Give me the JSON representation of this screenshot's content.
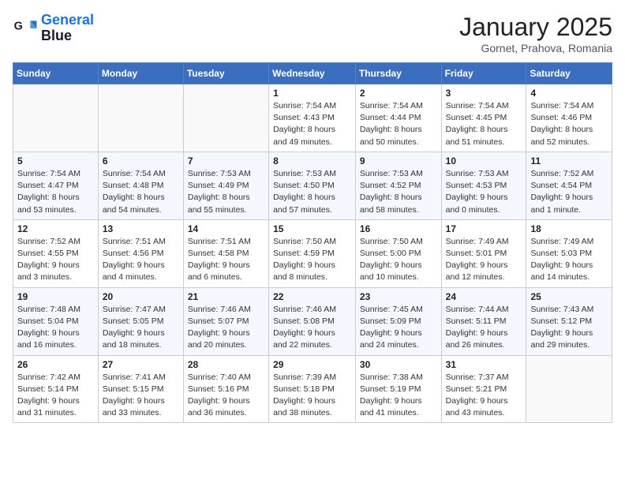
{
  "logo": {
    "line1": "General",
    "line2": "Blue"
  },
  "title": "January 2025",
  "location": "Gornet, Prahova, Romania",
  "weekdays": [
    "Sunday",
    "Monday",
    "Tuesday",
    "Wednesday",
    "Thursday",
    "Friday",
    "Saturday"
  ],
  "weeks": [
    [
      {
        "day": "",
        "info": ""
      },
      {
        "day": "",
        "info": ""
      },
      {
        "day": "",
        "info": ""
      },
      {
        "day": "1",
        "info": "Sunrise: 7:54 AM\nSunset: 4:43 PM\nDaylight: 8 hours\nand 49 minutes."
      },
      {
        "day": "2",
        "info": "Sunrise: 7:54 AM\nSunset: 4:44 PM\nDaylight: 8 hours\nand 50 minutes."
      },
      {
        "day": "3",
        "info": "Sunrise: 7:54 AM\nSunset: 4:45 PM\nDaylight: 8 hours\nand 51 minutes."
      },
      {
        "day": "4",
        "info": "Sunrise: 7:54 AM\nSunset: 4:46 PM\nDaylight: 8 hours\nand 52 minutes."
      }
    ],
    [
      {
        "day": "5",
        "info": "Sunrise: 7:54 AM\nSunset: 4:47 PM\nDaylight: 8 hours\nand 53 minutes."
      },
      {
        "day": "6",
        "info": "Sunrise: 7:54 AM\nSunset: 4:48 PM\nDaylight: 8 hours\nand 54 minutes."
      },
      {
        "day": "7",
        "info": "Sunrise: 7:53 AM\nSunset: 4:49 PM\nDaylight: 8 hours\nand 55 minutes."
      },
      {
        "day": "8",
        "info": "Sunrise: 7:53 AM\nSunset: 4:50 PM\nDaylight: 8 hours\nand 57 minutes."
      },
      {
        "day": "9",
        "info": "Sunrise: 7:53 AM\nSunset: 4:52 PM\nDaylight: 8 hours\nand 58 minutes."
      },
      {
        "day": "10",
        "info": "Sunrise: 7:53 AM\nSunset: 4:53 PM\nDaylight: 9 hours\nand 0 minutes."
      },
      {
        "day": "11",
        "info": "Sunrise: 7:52 AM\nSunset: 4:54 PM\nDaylight: 9 hours\nand 1 minute."
      }
    ],
    [
      {
        "day": "12",
        "info": "Sunrise: 7:52 AM\nSunset: 4:55 PM\nDaylight: 9 hours\nand 3 minutes."
      },
      {
        "day": "13",
        "info": "Sunrise: 7:51 AM\nSunset: 4:56 PM\nDaylight: 9 hours\nand 4 minutes."
      },
      {
        "day": "14",
        "info": "Sunrise: 7:51 AM\nSunset: 4:58 PM\nDaylight: 9 hours\nand 6 minutes."
      },
      {
        "day": "15",
        "info": "Sunrise: 7:50 AM\nSunset: 4:59 PM\nDaylight: 9 hours\nand 8 minutes."
      },
      {
        "day": "16",
        "info": "Sunrise: 7:50 AM\nSunset: 5:00 PM\nDaylight: 9 hours\nand 10 minutes."
      },
      {
        "day": "17",
        "info": "Sunrise: 7:49 AM\nSunset: 5:01 PM\nDaylight: 9 hours\nand 12 minutes."
      },
      {
        "day": "18",
        "info": "Sunrise: 7:49 AM\nSunset: 5:03 PM\nDaylight: 9 hours\nand 14 minutes."
      }
    ],
    [
      {
        "day": "19",
        "info": "Sunrise: 7:48 AM\nSunset: 5:04 PM\nDaylight: 9 hours\nand 16 minutes."
      },
      {
        "day": "20",
        "info": "Sunrise: 7:47 AM\nSunset: 5:05 PM\nDaylight: 9 hours\nand 18 minutes."
      },
      {
        "day": "21",
        "info": "Sunrise: 7:46 AM\nSunset: 5:07 PM\nDaylight: 9 hours\nand 20 minutes."
      },
      {
        "day": "22",
        "info": "Sunrise: 7:46 AM\nSunset: 5:08 PM\nDaylight: 9 hours\nand 22 minutes."
      },
      {
        "day": "23",
        "info": "Sunrise: 7:45 AM\nSunset: 5:09 PM\nDaylight: 9 hours\nand 24 minutes."
      },
      {
        "day": "24",
        "info": "Sunrise: 7:44 AM\nSunset: 5:11 PM\nDaylight: 9 hours\nand 26 minutes."
      },
      {
        "day": "25",
        "info": "Sunrise: 7:43 AM\nSunset: 5:12 PM\nDaylight: 9 hours\nand 29 minutes."
      }
    ],
    [
      {
        "day": "26",
        "info": "Sunrise: 7:42 AM\nSunset: 5:14 PM\nDaylight: 9 hours\nand 31 minutes."
      },
      {
        "day": "27",
        "info": "Sunrise: 7:41 AM\nSunset: 5:15 PM\nDaylight: 9 hours\nand 33 minutes."
      },
      {
        "day": "28",
        "info": "Sunrise: 7:40 AM\nSunset: 5:16 PM\nDaylight: 9 hours\nand 36 minutes."
      },
      {
        "day": "29",
        "info": "Sunrise: 7:39 AM\nSunset: 5:18 PM\nDaylight: 9 hours\nand 38 minutes."
      },
      {
        "day": "30",
        "info": "Sunrise: 7:38 AM\nSunset: 5:19 PM\nDaylight: 9 hours\nand 41 minutes."
      },
      {
        "day": "31",
        "info": "Sunrise: 7:37 AM\nSunset: 5:21 PM\nDaylight: 9 hours\nand 43 minutes."
      },
      {
        "day": "",
        "info": ""
      }
    ]
  ]
}
